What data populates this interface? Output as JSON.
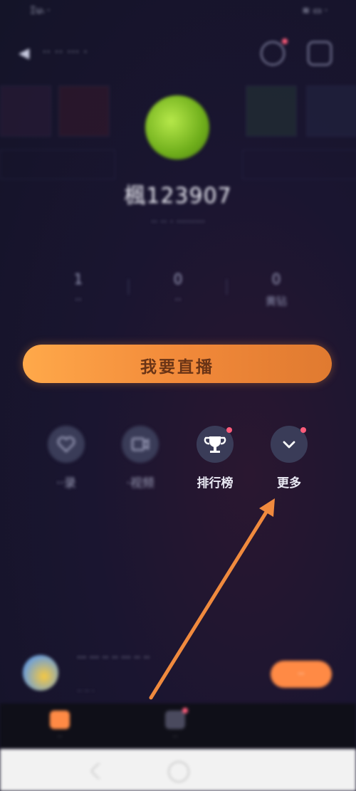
{
  "status_bar": {
    "left": "Ξ∪ᵢ ·",
    "right": "≋ ▭ ·"
  },
  "header": {
    "title": "·· ·· ··· ·",
    "back_icon": "back-arrow-icon"
  },
  "profile": {
    "nickname": "楓123907",
    "uid_line": "·· ·· · ·········",
    "stats": [
      {
        "value": "1",
        "label": "··"
      },
      {
        "value": "0",
        "label": "··"
      },
      {
        "value": "0",
        "label": "黄钻"
      }
    ]
  },
  "live_button": {
    "label": "我要直播"
  },
  "menu": {
    "items": [
      {
        "label": "··录",
        "icon": "heart-icon"
      },
      {
        "label": "·视频",
        "icon": "video-icon"
      },
      {
        "label": "排行榜",
        "icon": "trophy-icon"
      },
      {
        "label": "更多",
        "icon": "chevron-down-icon"
      }
    ]
  },
  "banner": {
    "text": "··· ··· ·· ·· ··· ·· ··",
    "sub": "·· ·· ·",
    "button": "··"
  },
  "tabs": [
    {
      "label": "··"
    },
    {
      "label": "··"
    }
  ],
  "colors": {
    "accent": "#ff8a45",
    "live_button_text": "#6a3416",
    "badge": "#ff5c7a",
    "annotation_arrow": "#f08a3e"
  }
}
